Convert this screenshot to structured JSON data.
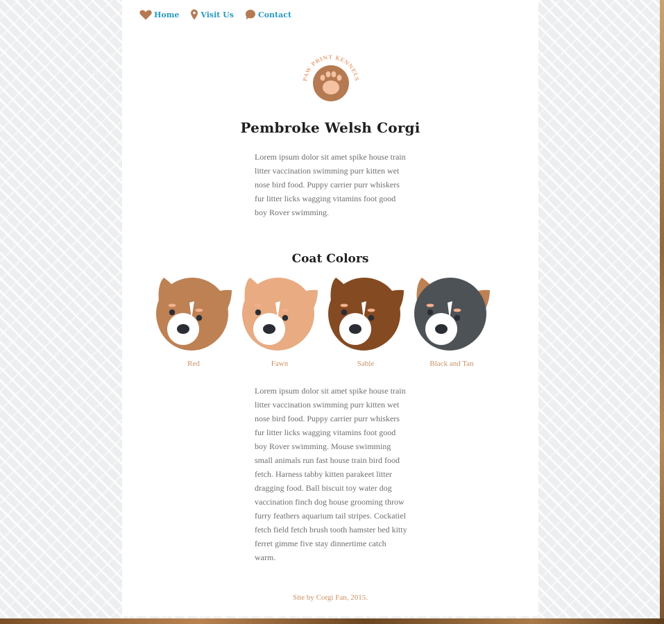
{
  "nav": {
    "items": [
      {
        "label": "Home",
        "icon": "heart-icon"
      },
      {
        "label": "Visit Us",
        "icon": "map-pin-icon"
      },
      {
        "label": "Contact",
        "icon": "speech-bubble-icon"
      }
    ]
  },
  "logo": {
    "text": "PAW PRINT KENNELS"
  },
  "page": {
    "title": "Pembroke Welsh Corgi",
    "intro": "Lorem ipsum dolor sit amet spike house train litter vaccination swimming purr kitten wet nose bird food. Puppy carrier purr whiskers fur litter licks wagging vitamins foot good boy Rover swimming."
  },
  "coat_section": {
    "title": "Coat Colors",
    "colors": [
      {
        "label": "Red",
        "ear": "#bd8154",
        "face": "#bd8154",
        "icon": "corgi-red-icon"
      },
      {
        "label": "Fawn",
        "ear": "#e8ab82",
        "face": "#e8ab82",
        "icon": "corgi-fawn-icon"
      },
      {
        "label": "Sable",
        "ear": "#844a22",
        "face": "#844a22",
        "icon": "corgi-sable-icon"
      },
      {
        "label": "Black and Tan",
        "ear": "#bd8154",
        "face": "#4d5257",
        "icon": "corgi-black-and-tan-icon"
      }
    ],
    "body": "Lorem ipsum dolor sit amet spike house train litter vaccination swimming purr kitten wet nose bird food. Puppy carrier purr whiskers fur litter licks wagging vitamins foot good boy Rover swimming. Mouse swimming small animals run fast house train bird food fetch. Harness tabby kitten parakeet litter dragging food. Ball biscuit toy water dog vaccination finch dog house grooming throw furry feathers aquarium tail stripes. Cockatiel fetch field fetch brush tooth hamster bed kitty ferret gimme five stay dinnertime catch warm."
  },
  "footer": {
    "text": "Site by Corgi Fan, 2015."
  },
  "colors": {
    "link": "#2a9bc1",
    "brand_brown": "#b57a52",
    "accent_tan": "#c99062"
  }
}
